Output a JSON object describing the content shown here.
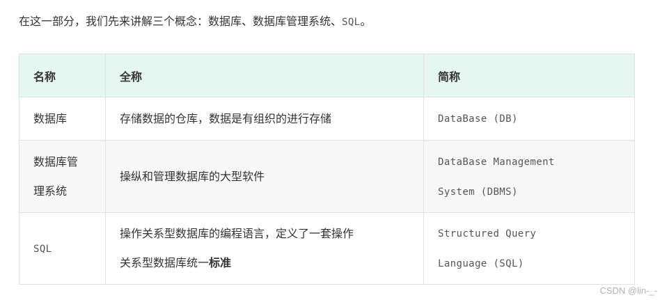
{
  "intro": {
    "text": "在这一部分，我们先来讲解三个概念：数据库、数据库管理系统、",
    "code": "SQL",
    "end": "。"
  },
  "table": {
    "headers": [
      "名称",
      "全称",
      "简称"
    ],
    "rows": [
      {
        "name_lines": [
          "数据库"
        ],
        "full_lines": [
          "存储数据的仓库，数据是有组织的进行存储"
        ],
        "full_bold": "",
        "abbr_lines": [
          "DataBase (DB)"
        ]
      },
      {
        "name_lines": [
          "数据库管",
          "理系统"
        ],
        "full_lines": [
          "操纵和管理数据库的大型软件"
        ],
        "full_bold": "",
        "abbr_lines": [
          "DataBase Management",
          "System (DBMS)"
        ]
      },
      {
        "name_lines": [
          "SQL"
        ],
        "full_lines": [
          "操作关系型数据库的编程语言，定义了一套操作",
          "关系型数据库统一"
        ],
        "full_bold": "标准",
        "abbr_lines": [
          "Structured Query",
          "Language (SQL)"
        ]
      }
    ]
  },
  "watermark": "CSDN @lin-_-"
}
